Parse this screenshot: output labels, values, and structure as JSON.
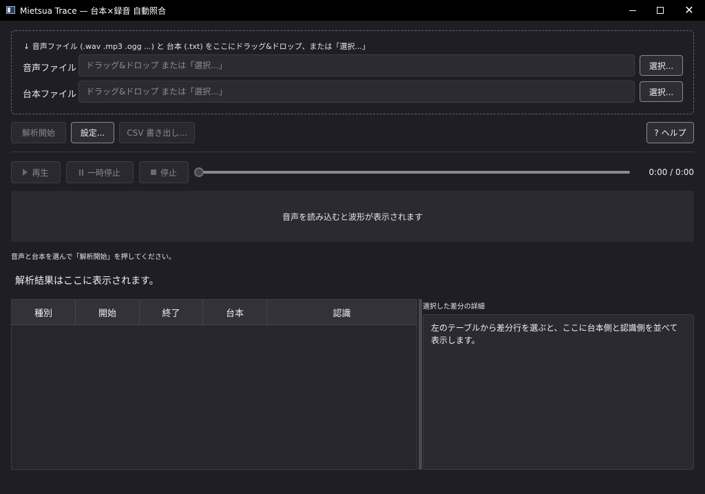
{
  "window": {
    "title": "Mietsua Trace — 台本×録音 自動照合"
  },
  "dropzone": {
    "hint": "↓ 音声ファイル (.wav .mp3 .ogg ...) と 台本 (.txt) をここにドラッグ&ドロップ、または「選択...」",
    "audio_label": "音声ファイル",
    "audio_placeholder": "ドラッグ&ドロップ または「選択...」",
    "script_label": "台本ファイル",
    "script_placeholder": "ドラッグ&ドロップ または「選択...」",
    "select_label": "選択..."
  },
  "toolbar": {
    "analyze_label": "解析開始",
    "settings_label": "設定...",
    "csv_label": "CSV 書き出し...",
    "help_label": "? ヘルプ"
  },
  "playback": {
    "play_label": "再生",
    "pause_label": "一時停止",
    "stop_label": "停止",
    "time": "0:00 / 0:00",
    "position_fraction": 0
  },
  "waveform": {
    "placeholder": "音声を読み込むと波形が表示されます"
  },
  "status": {
    "text": "音声と台本を選んで「解析開始」を押してください。",
    "result_heading": "解析結果はここに表示されます。"
  },
  "table": {
    "columns": [
      "種別",
      "開始",
      "終了",
      "台本",
      "認識"
    ]
  },
  "detail": {
    "title": "選択した差分の詳細",
    "text": "左のテーブルから差分行を選ぶと、ここに台本側と認識側を並べて表示します。"
  },
  "icons": {
    "play": "play-icon",
    "pause": "pause-icon",
    "stop": "stop-icon"
  }
}
